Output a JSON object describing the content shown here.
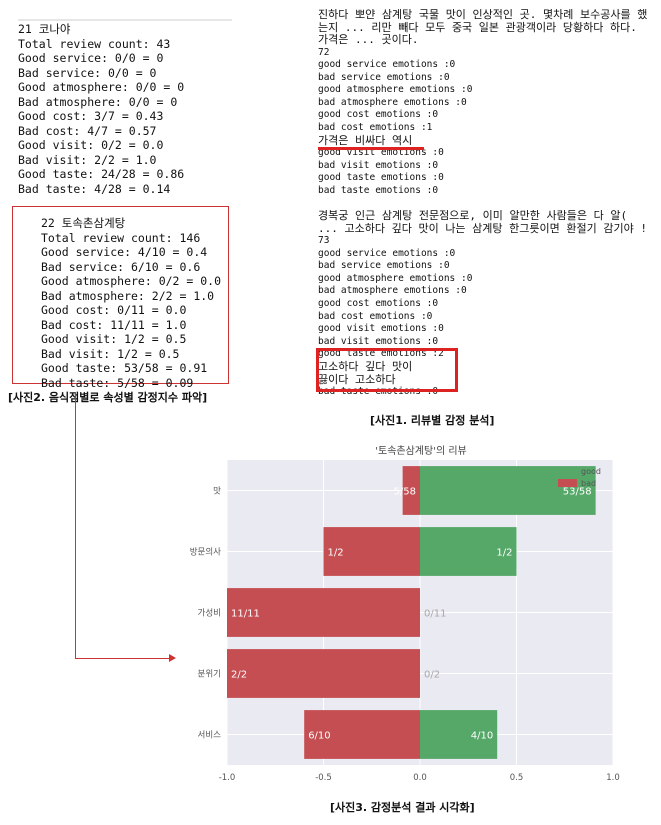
{
  "left_top": {
    "lines": [
      "21 코나야",
      "Total review count: 43",
      "Good service: 0/0 = 0",
      "Bad service: 0/0 = 0",
      "Good atmosphere: 0/0 = 0",
      "Bad atmosphere: 0/0 = 0",
      "Good cost: 3/7 = 0.43",
      "Bad cost: 4/7 = 0.57",
      "Good visit: 0/2 = 0.0",
      "Bad visit: 2/2 = 1.0",
      "Good taste: 24/28 = 0.86",
      "Bad taste: 4/28 = 0.14"
    ]
  },
  "left_box": {
    "lines": [
      "22 토속촌삼계탕",
      "Total review count: 146",
      "Good service: 4/10 = 0.4",
      "Bad service: 6/10 = 0.6",
      "Good atmosphere: 0/2 = 0.0",
      "Bad atmosphere: 2/2 = 1.0",
      "Good cost: 0/11 = 0.0",
      "Bad cost: 11/11 = 1.0",
      "Good visit: 1/2 = 0.5",
      "Bad visit: 1/2 = 0.5",
      "Good taste: 53/58 = 0.91",
      "Bad taste: 5/58 = 0.09"
    ]
  },
  "captions": {
    "left": "[사진2. 음식점별로 속성별 감정지수 파악]",
    "right": "[사진1. 리뷰별 감정 분석]",
    "bottom": "[사진3. 감정분석 결과 시각화]"
  },
  "right_top": {
    "paragraph": "진하다 뽀얀 삼계탕 국물 맛이 인상적인 곳. 몇차례 보수공사를 했는지 ... 리만 빼다 모두 중국 일본 관광객이라 당황하다 하다. 가격은 ... 곳이다.",
    "number": "72",
    "lines": [
      "good service emotions :0",
      "bad service emotions :0",
      "good atmosphere emotions :0",
      "bad atmosphere emotions :0",
      "good cost emotions :0",
      "bad cost emotions :1",
      "가격은 비싸다 역시",
      "good visit emotions :0",
      "bad visit emotions :0",
      "good taste emotions :0",
      "bad taste emotions :0"
    ]
  },
  "right_bottom": {
    "paragraph": "경복궁 인근 삼계탕 전문점으로, 이미 알만한 사람들은 다 알( ... 고소하다 깊다 맛이 나는 삼계탕 한그릇이면 환절기 감기야 !",
    "number": "73",
    "lines": [
      "good service emotions :0",
      "bad service emotions :0",
      "good atmosphere emotions :0",
      "bad atmosphere emotions :0",
      "good cost emotions :0",
      "bad cost emotions :0",
      "good visit emotions :0",
      "bad visit emotions :0",
      "good taste emotions :2",
      "고소하다 깊다 맛이",
      "끓이다 고소하다",
      "bad taste emotions :0"
    ]
  },
  "chart_data": {
    "type": "bar",
    "orientation": "horizontal-diverging",
    "title": "'토속촌삼계탕'의 리뷰",
    "categories": [
      "맛",
      "재방문의사",
      "가성비",
      "분위기",
      "서비스"
    ],
    "series": [
      {
        "name": "good",
        "values": [
          0.91,
          0.5,
          0.0,
          0.0,
          0.4
        ],
        "labels": [
          "53/58",
          "1/2",
          "0/11",
          "0/2",
          "4/10"
        ],
        "color": "#55a868"
      },
      {
        "name": "bad",
        "values": [
          -0.09,
          -0.5,
          -1.0,
          -1.0,
          -0.6
        ],
        "labels": [
          "5/58",
          "1/2",
          "11/11",
          "2/2",
          "6/10"
        ],
        "color": "#c44e52"
      }
    ],
    "xlim": [
      -1.0,
      1.0
    ],
    "xticks": [
      "-1.0",
      "-0.5",
      "0.0",
      "0.5",
      "1.0"
    ],
    "legend_position": "top-right",
    "grid": true,
    "background": "#eaeaf2"
  }
}
